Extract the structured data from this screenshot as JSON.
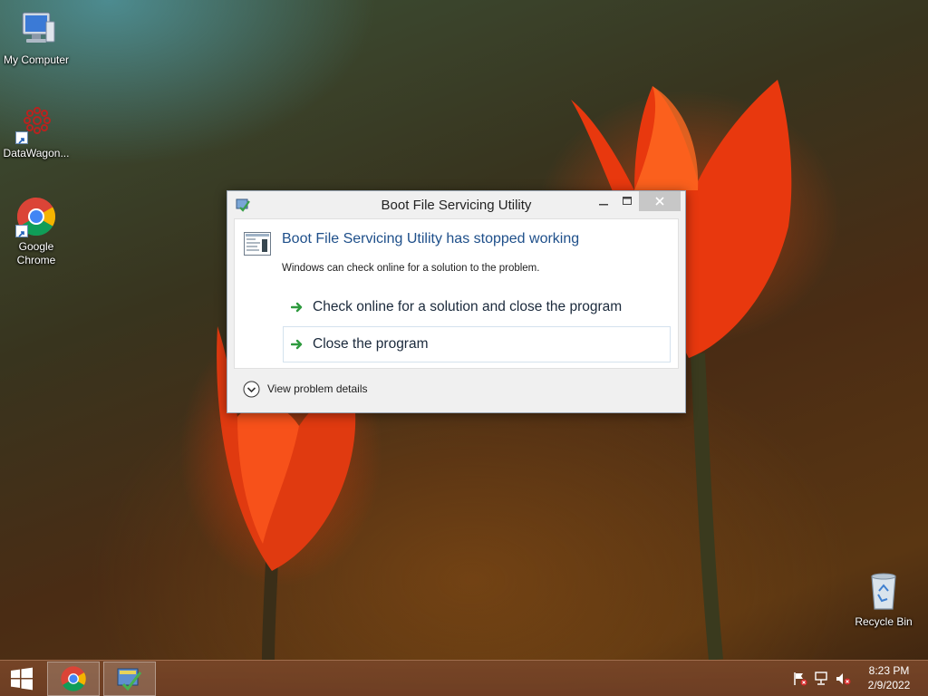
{
  "desktop": {
    "icons": [
      {
        "label": "My Computer"
      },
      {
        "label": "DataWagon..."
      },
      {
        "label": "Google Chrome"
      },
      {
        "label": "Recycle Bin"
      }
    ]
  },
  "dialog": {
    "title": "Boot File Servicing Utility",
    "heading": "Boot File Servicing Utility has stopped working",
    "message": "Windows can check online for a solution to the problem.",
    "commands": [
      {
        "label": "Check online for a solution and close the program"
      },
      {
        "label": "Close the program"
      }
    ],
    "details_label": "View problem details"
  },
  "taskbar": {
    "time": "8:23 PM",
    "date": "2/9/2022"
  },
  "colors": {
    "heading": "#1e4f8a",
    "arrow_green": "#2e9a3e",
    "taskbar": "#77462a"
  }
}
